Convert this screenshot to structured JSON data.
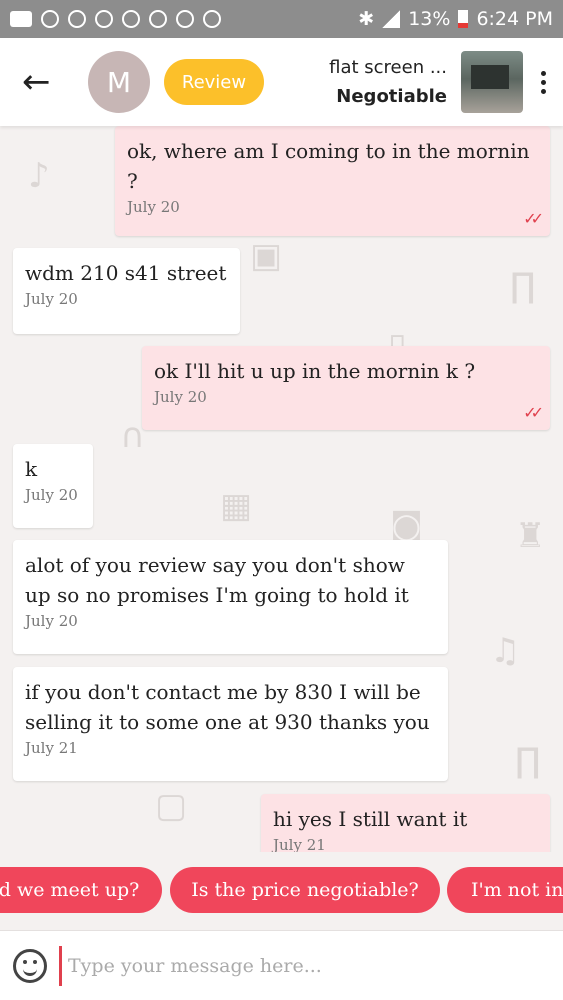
{
  "status_bar": {
    "battery": "13%",
    "time": "6:24 PM"
  },
  "header": {
    "back_icon": "back-arrow-icon",
    "avatar_letter": "M",
    "review_label": "Review",
    "listing_title": "flat screen ...",
    "listing_price": "Negotiable",
    "colors": {
      "review": "#fcc02a",
      "avatar": "#c7b6b5"
    }
  },
  "messages": [
    {
      "dir": "out",
      "text": "ok, where am I coming to in the mornin ?",
      "date": "July 20",
      "read": true
    },
    {
      "dir": "in",
      "text": "wdm 210 s41 street",
      "date": "July 20"
    },
    {
      "dir": "out",
      "text": "ok I'll hit u up in the mornin k ?",
      "date": "July 20",
      "read": true
    },
    {
      "dir": "in",
      "text": "k",
      "date": "July 20"
    },
    {
      "dir": "in",
      "text": "alot of you review say you don't show up so no promises I'm going to hold it",
      "date": "July 20"
    },
    {
      "dir": "in",
      "text": "if you don't contact me by 830 I will be selling it to some one at 930 thanks you",
      "date": "July 21"
    },
    {
      "dir": "out",
      "text": "hi yes I still want it",
      "date": "July 21",
      "read": true
    }
  ],
  "quick_replies": [
    "ld we meet up?",
    "Is the price negotiable?",
    "I'm not int"
  ],
  "composer": {
    "placeholder": "Type your message here...",
    "emoji_icon": "emoji-icon"
  },
  "colors": {
    "outgoing": "#fde2e5",
    "incoming": "#ffffff",
    "accent": "#f0465b",
    "read_ticks": "#e0404d"
  }
}
